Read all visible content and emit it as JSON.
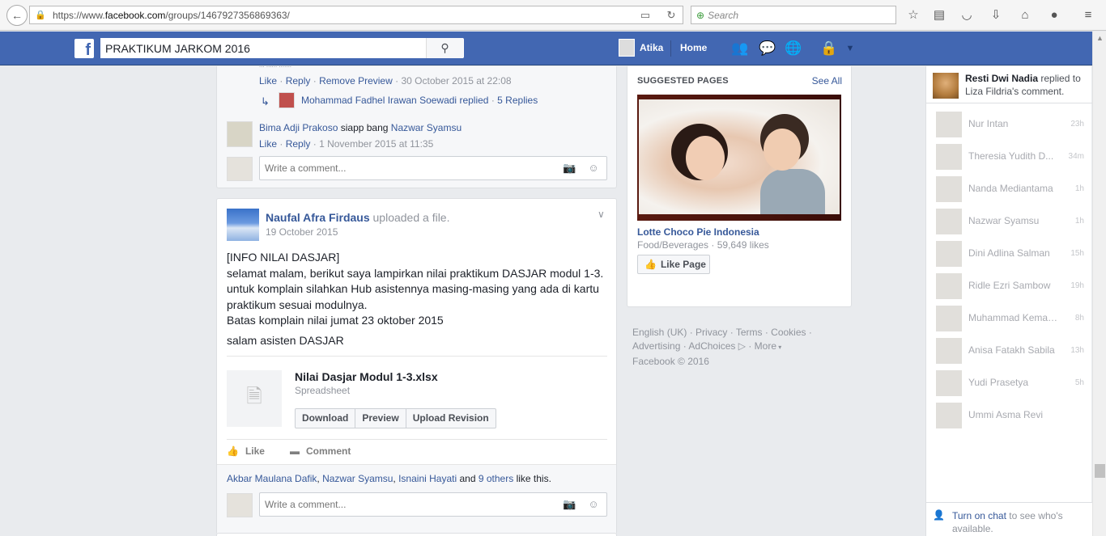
{
  "browser": {
    "url_prefix": "https://www.",
    "url_domain": "facebook.com",
    "url_path": "/groups/1467927356869363/",
    "search_placeholder": "Search"
  },
  "fb_header": {
    "search_value": "PRAKTIKUM JARKOM 2016",
    "user_name": "Atika",
    "home_label": "Home"
  },
  "comments": {
    "truncated_text": "... ...... .......",
    "c1_actions": {
      "like": "Like",
      "reply": "Reply",
      "remove_preview": "Remove Preview",
      "time": "30 October 2015 at 22:08"
    },
    "reply_summary": {
      "name": "Mohammad Fadhel Irawan Soewadi",
      "action": "replied",
      "replies": "5 Replies"
    },
    "c2": {
      "name": "Bima Adji Prakoso",
      "text": "siapp bang",
      "mention": "Nazwar Syamsu",
      "like": "Like",
      "reply": "Reply",
      "time": "1 November 2015 at 11:35"
    },
    "write_placeholder": "Write a comment..."
  },
  "post": {
    "author": "Naufal Afra Firdaus",
    "action": "uploaded a file.",
    "date": "19 October 2015",
    "body": [
      "[INFO NILAI DASJAR]",
      "selamat malam, berikut saya lampirkan nilai praktikum DASJAR modul 1-3.",
      "untuk komplain silahkan Hub asistennya masing-masing yang ada di kartu praktikum sesuai modulnya.",
      "Batas komplain nilai jumat 23 oktober 2015",
      "salam asisten DASJAR"
    ],
    "file": {
      "name": "Nilai Dasjar Modul 1-3.xlsx",
      "type": "Spreadsheet",
      "download": "Download",
      "preview": "Preview",
      "upload_revision": "Upload Revision"
    },
    "like_label": "Like",
    "comment_label": "Comment",
    "likes": {
      "p1": "Akbar Maulana Dafik",
      "p2": "Nazwar Syamsu",
      "p3": "Isnaini Hayati",
      "and": "and",
      "others": "9 others",
      "suffix": "like this."
    },
    "write_placeholder": "Write a comment..."
  },
  "suggested": {
    "title": "SUGGESTED PAGES",
    "see_all": "See All",
    "page_name": "Lotte Choco Pie Indonesia",
    "category": "Food/Beverages",
    "likes": "59,649 likes",
    "like_button": "Like Page"
  },
  "footer": {
    "links": [
      "English (UK)",
      "Privacy",
      "Terms",
      "Cookies",
      "Advertising",
      "AdChoices",
      "More"
    ],
    "copyright": "Facebook © 2016"
  },
  "chat": {
    "ticker": {
      "name": "Resti Dwi Nadia",
      "text": "replied to Liza Fildria's comment."
    },
    "contacts": [
      {
        "name": "Nur Intan",
        "time": "23h"
      },
      {
        "name": "Theresia Yudith D...",
        "time": "34m"
      },
      {
        "name": "Nanda Mediantama",
        "time": "1h"
      },
      {
        "name": "Nazwar Syamsu",
        "time": "1h"
      },
      {
        "name": "Dini Adlina Salman",
        "time": "15h"
      },
      {
        "name": "Ridle Ezri Sambow",
        "time": "19h"
      },
      {
        "name": "Muhammad Kemas ...",
        "time": "8h"
      },
      {
        "name": "Anisa Fatakh Sabila",
        "time": "13h"
      },
      {
        "name": "Yudi Prasetya",
        "time": "5h"
      },
      {
        "name": "Ummi Asma Revi",
        "time": ""
      }
    ],
    "footer_link": "Turn on chat",
    "footer_text": "to see who's available."
  }
}
